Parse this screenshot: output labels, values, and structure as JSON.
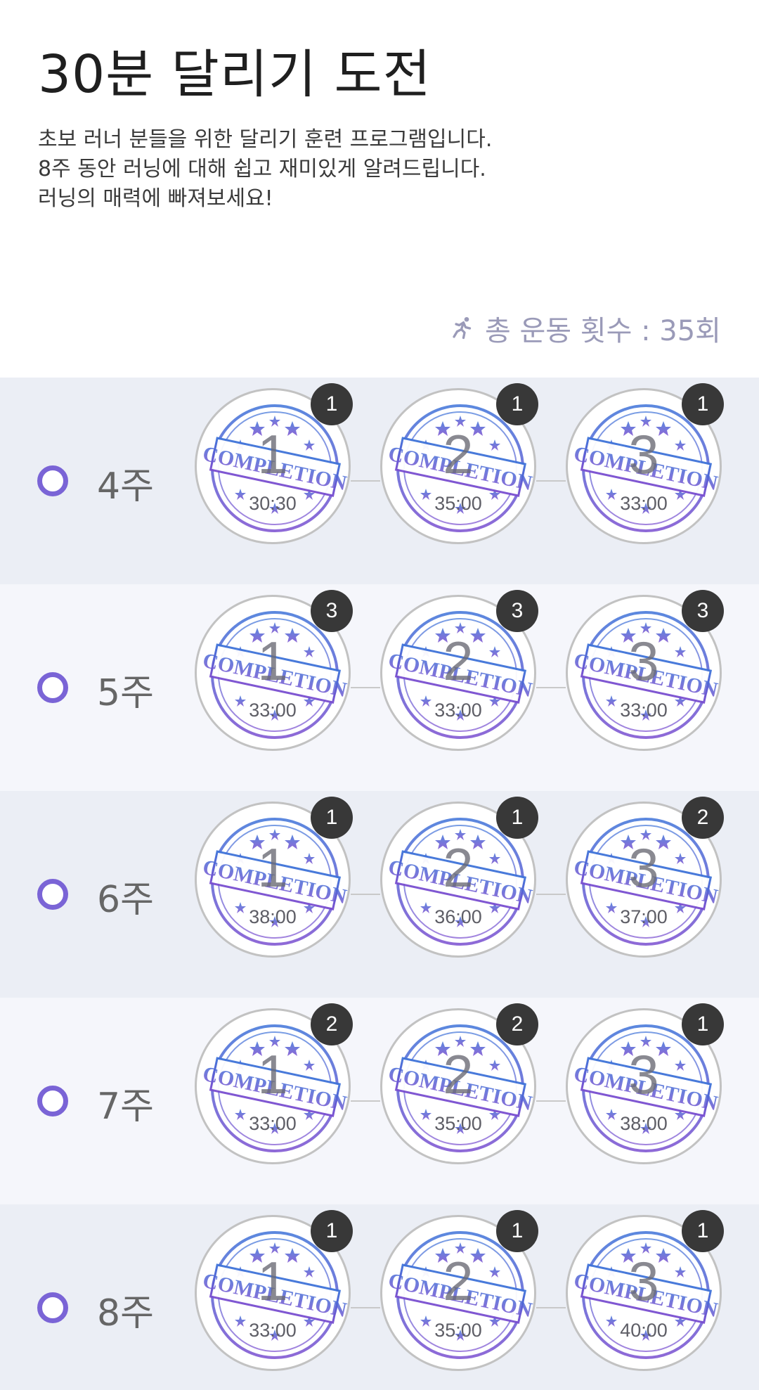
{
  "header": {
    "title": "30분 달리기 도전",
    "description": [
      "초보 러너 분들을 위한 달리기 훈련 프로그램입니다.",
      "8주 동안 러닝에 대해 쉽고 재미있게 알려드립니다.",
      "러닝의 매력에 빠져보세요!"
    ],
    "total_workouts": "총 운동 횟수 : 35회",
    "total_icon": "running-person-icon"
  },
  "colors": {
    "accent": "#7a64d6",
    "stamp_blue": "#3f73d9",
    "stamp_purple": "#7a4fd0",
    "badge": "#383838"
  },
  "stamp_text": "COMPLETION",
  "weeks": [
    {
      "label": "4주",
      "days": [
        {
          "num": "1",
          "time": "30:30",
          "count": "1"
        },
        {
          "num": "2",
          "time": "35:00",
          "count": "1"
        },
        {
          "num": "3",
          "time": "33:00",
          "count": "1"
        }
      ]
    },
    {
      "label": "5주",
      "days": [
        {
          "num": "1",
          "time": "33:00",
          "count": "3"
        },
        {
          "num": "2",
          "time": "33:00",
          "count": "3"
        },
        {
          "num": "3",
          "time": "33:00",
          "count": "3"
        }
      ]
    },
    {
      "label": "6주",
      "days": [
        {
          "num": "1",
          "time": "38:00",
          "count": "1"
        },
        {
          "num": "2",
          "time": "36:00",
          "count": "1"
        },
        {
          "num": "3",
          "time": "37:00",
          "count": "2"
        }
      ]
    },
    {
      "label": "7주",
      "days": [
        {
          "num": "1",
          "time": "33:00",
          "count": "2"
        },
        {
          "num": "2",
          "time": "35:00",
          "count": "2"
        },
        {
          "num": "3",
          "time": "38:00",
          "count": "1"
        }
      ]
    },
    {
      "label": "8주",
      "days": [
        {
          "num": "1",
          "time": "33:00",
          "count": "1"
        },
        {
          "num": "2",
          "time": "35:00",
          "count": "1"
        },
        {
          "num": "3",
          "time": "40:00",
          "count": "1"
        }
      ]
    }
  ]
}
